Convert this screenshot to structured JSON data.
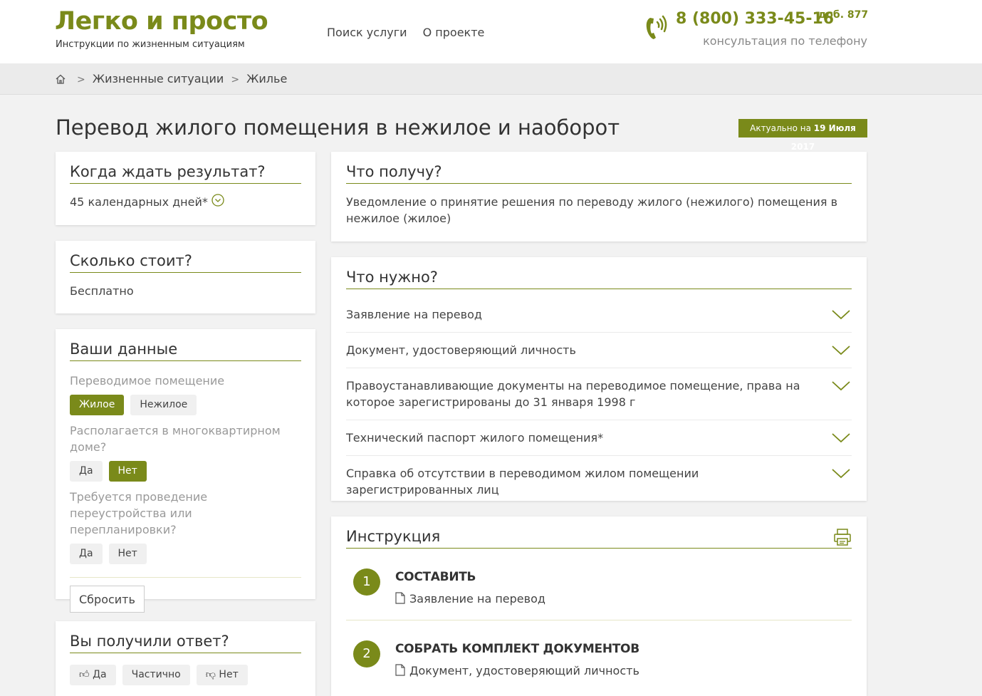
{
  "header": {
    "logo_title": "Легко и просто",
    "logo_subtitle": "Инструкции по жизненным ситуациям",
    "nav": [
      "Поиск услуги",
      "О проекте"
    ],
    "phone": "8 (800) 333-45-16",
    "phone_ext": "доб. 877",
    "phone_note": "консультация по телефону"
  },
  "breadcrumb": [
    "Жизненные ситуации",
    "Жилье"
  ],
  "page_title": "Перевод жилого помещения в нежилое и наоборот",
  "actual": {
    "prefix": "Актуально на",
    "date": "19 Июля 2017"
  },
  "when": {
    "title": "Когда ждать результат?",
    "value": "45 календарных дней*"
  },
  "cost": {
    "title": "Сколько стоит?",
    "value": "Бесплатно"
  },
  "your_data": {
    "title": "Ваши данные",
    "q1": {
      "label": "Переводимое помещение",
      "options": [
        "Жилое",
        "Нежилое"
      ],
      "selected": "Жилое"
    },
    "q2": {
      "label": "Располагается в многоквартирном доме?",
      "options": [
        "Да",
        "Нет"
      ],
      "selected": "Нет"
    },
    "q3": {
      "label": "Требуется проведение переустройства или перепланировки?",
      "options": [
        "Да",
        "Нет"
      ],
      "selected": ""
    },
    "reset": "Сбросить"
  },
  "feedback": {
    "title": "Вы получили ответ?",
    "options": [
      "Да",
      "Частично",
      "Нет"
    ]
  },
  "result": {
    "title": "Что получу?",
    "text": "Уведомление о принятие решения по переводу жилого (нежилого) помещения в нежилое (жилое)"
  },
  "needed": {
    "title": "Что нужно?",
    "items": [
      "Заявление на перевод",
      "Документ, удостоверяющий личность",
      "Правоустанавливающие документы на переводимое помещение, права на которое зарегистрированы до 31 января 1998 г",
      "Технический паспорт жилого помещения*",
      "Справка об отсутствии в переводимом жилом помещении зарегистрированных лиц"
    ]
  },
  "instruction": {
    "title": "Инструкция",
    "steps": [
      {
        "num": "1",
        "title": "СОСТАВИТЬ",
        "doc": "Заявление на перевод"
      },
      {
        "num": "2",
        "title": "СОБРАТЬ КОМПЛЕКТ ДОКУМЕНТОВ",
        "doc": "Документ, удостоверяющий личность"
      }
    ]
  }
}
